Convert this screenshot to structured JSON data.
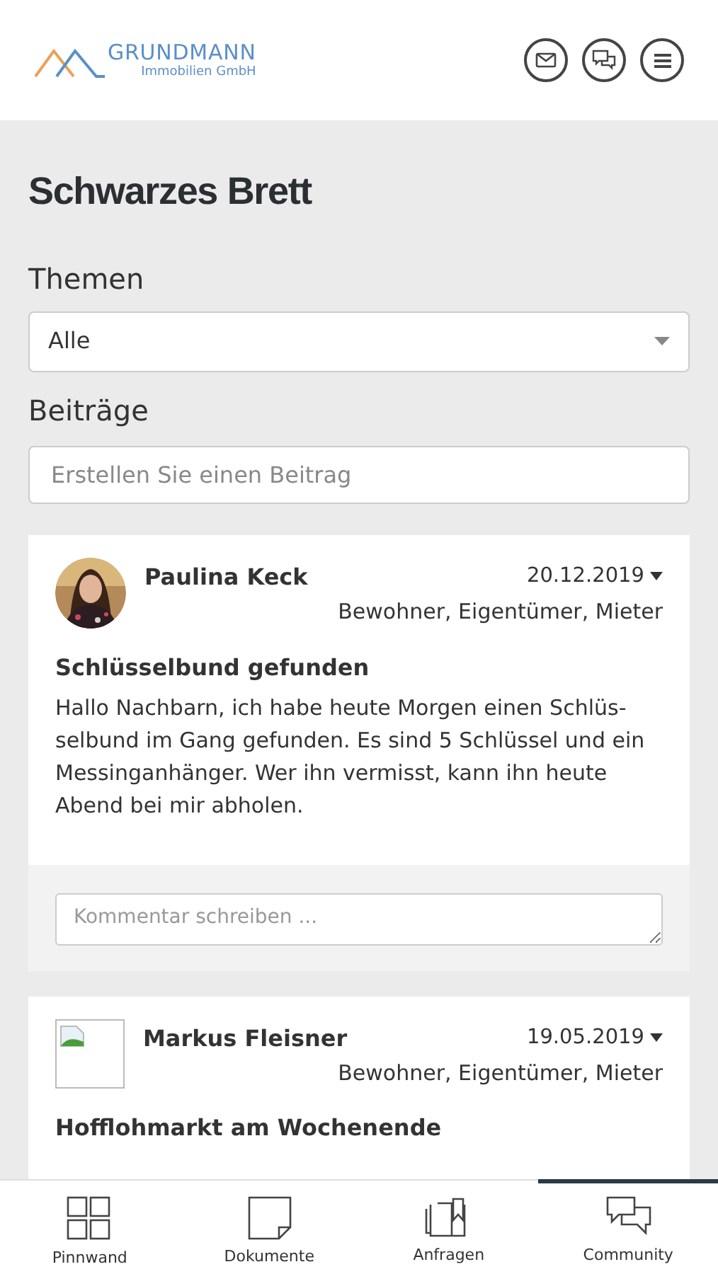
{
  "header": {
    "logo_name": "GRUNDMANN",
    "logo_sub": "Immobilien GmbH"
  },
  "page_title": "Schwarzes Brett",
  "topics": {
    "label": "Themen",
    "value": "Alle"
  },
  "posts_section": {
    "label": "Beiträge",
    "placeholder": "Erstellen Sie einen Beitrag"
  },
  "posts": [
    {
      "author": "Paulina Keck",
      "date": "20.12.2019",
      "audience": "Bewohner, Eigentümer, Mieter",
      "title": "Schlüsselbund gefunden",
      "body": "Hallo Nachbarn, ich habe heute Morgen einen Schlüs-selbund im Gang gefunden. Es sind 5 Schlüssel und ein Messinganhänger. Wer ihn vermisst, kann ihn heute Abend bei mir abholen.",
      "comment_placeholder": "Kommentar schreiben ..."
    },
    {
      "author": "Markus Fleisner",
      "kind": "broken",
      "date": "19.05.2019",
      "audience": "Bewohner, Eigentümer, Mieter",
      "title": "Hofflohmarkt am Wochenende"
    }
  ],
  "nav": [
    {
      "label": "Pinnwand",
      "selected": false
    },
    {
      "label": "Dokumente",
      "selected": false
    },
    {
      "label": "Anfragen",
      "selected": false
    },
    {
      "label": "Community",
      "selected": true
    }
  ]
}
